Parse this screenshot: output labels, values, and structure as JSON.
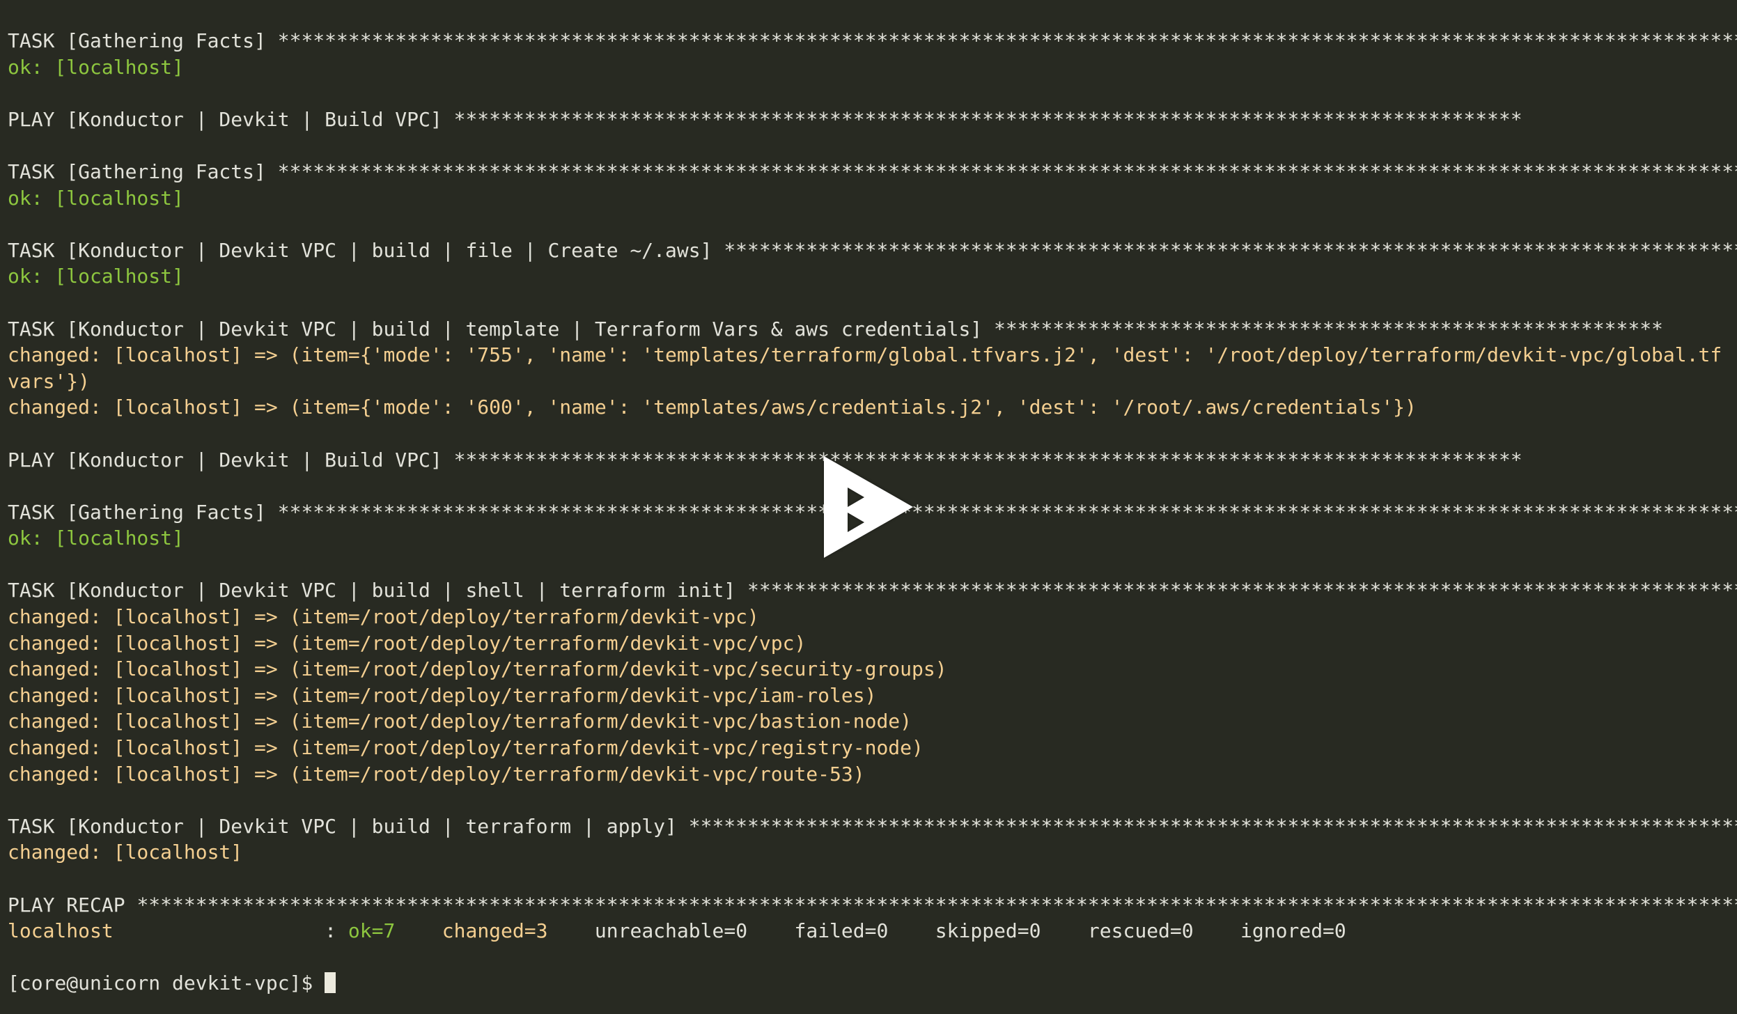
{
  "terminal": {
    "background_color": "#282a22",
    "foreground_color": "#e2e2da",
    "ok_color": "#8dc63f",
    "changed_color": "#f4cf91",
    "cursor_color": "#eceade",
    "columns": 146,
    "lines": [
      {
        "id": "l01",
        "segments": [
          {
            "cls": "c-default",
            "text": "TASK [Gathering Facts] "
          },
          {
            "cls": "c-stars",
            "text": "*****************************************************************************************************************************"
          }
        ]
      },
      {
        "id": "l02",
        "segments": [
          {
            "cls": "c-ok",
            "text": "ok: [localhost]"
          }
        ]
      },
      {
        "id": "l03",
        "segments": [
          {
            "cls": "c-default",
            "text": ""
          }
        ]
      },
      {
        "id": "l04",
        "segments": [
          {
            "cls": "c-default",
            "text": "PLAY [Konductor | Devkit | Build VPC] "
          },
          {
            "cls": "c-stars",
            "text": "*******************************************************************************************"
          }
        ]
      },
      {
        "id": "l05",
        "segments": [
          {
            "cls": "c-default",
            "text": ""
          }
        ]
      },
      {
        "id": "l06",
        "segments": [
          {
            "cls": "c-default",
            "text": "TASK [Gathering Facts] "
          },
          {
            "cls": "c-stars",
            "text": "*****************************************************************************************************************************"
          }
        ]
      },
      {
        "id": "l07",
        "segments": [
          {
            "cls": "c-ok",
            "text": "ok: [localhost]"
          }
        ]
      },
      {
        "id": "l08",
        "segments": [
          {
            "cls": "c-default",
            "text": ""
          }
        ]
      },
      {
        "id": "l09",
        "segments": [
          {
            "cls": "c-default",
            "text": "TASK [Konductor | Devkit VPC | build | file | Create ~/.aws] "
          },
          {
            "cls": "c-stars",
            "text": "********************************************************************************************"
          }
        ]
      },
      {
        "id": "l10",
        "segments": [
          {
            "cls": "c-ok",
            "text": "ok: [localhost]"
          }
        ]
      },
      {
        "id": "l11",
        "segments": [
          {
            "cls": "c-default",
            "text": ""
          }
        ]
      },
      {
        "id": "l12",
        "segments": [
          {
            "cls": "c-default",
            "text": "TASK [Konductor | Devkit VPC | build | template | Terraform Vars & aws credentials] "
          },
          {
            "cls": "c-stars",
            "text": "*********************************************************"
          }
        ]
      },
      {
        "id": "l13",
        "segments": [
          {
            "cls": "c-changed",
            "text": "changed: [localhost] => (item={'mode': '755', 'name': 'templates/terraform/global.tfvars.j2', 'dest': '/root/deploy/terraform/devkit-vpc/global.tf"
          }
        ]
      },
      {
        "id": "l14",
        "segments": [
          {
            "cls": "c-changed",
            "text": "vars'})"
          }
        ]
      },
      {
        "id": "l15",
        "segments": [
          {
            "cls": "c-changed",
            "text": "changed: [localhost] => (item={'mode': '600', 'name': 'templates/aws/credentials.j2', 'dest': '/root/.aws/credentials'})"
          }
        ]
      },
      {
        "id": "l16",
        "segments": [
          {
            "cls": "c-default",
            "text": ""
          }
        ]
      },
      {
        "id": "l17",
        "segments": [
          {
            "cls": "c-default",
            "text": "PLAY [Konductor | Devkit | Build VPC] "
          },
          {
            "cls": "c-stars",
            "text": "*******************************************************************************************"
          }
        ]
      },
      {
        "id": "l18",
        "segments": [
          {
            "cls": "c-default",
            "text": ""
          }
        ]
      },
      {
        "id": "l19",
        "segments": [
          {
            "cls": "c-default",
            "text": "TASK [Gathering Facts] "
          },
          {
            "cls": "c-stars",
            "text": "*****************************************************************************************************************************"
          }
        ]
      },
      {
        "id": "l20",
        "segments": [
          {
            "cls": "c-ok",
            "text": "ok: [localhost]"
          }
        ]
      },
      {
        "id": "l21",
        "segments": [
          {
            "cls": "c-default",
            "text": ""
          }
        ]
      },
      {
        "id": "l22",
        "segments": [
          {
            "cls": "c-default",
            "text": "TASK [Konductor | Devkit VPC | build | shell | terraform init] "
          },
          {
            "cls": "c-stars",
            "text": "******************************************************************************************"
          }
        ]
      },
      {
        "id": "l23",
        "segments": [
          {
            "cls": "c-changed",
            "text": "changed: [localhost] => (item=/root/deploy/terraform/devkit-vpc)"
          }
        ]
      },
      {
        "id": "l24",
        "segments": [
          {
            "cls": "c-changed",
            "text": "changed: [localhost] => (item=/root/deploy/terraform/devkit-vpc/vpc)"
          }
        ]
      },
      {
        "id": "l25",
        "segments": [
          {
            "cls": "c-changed",
            "text": "changed: [localhost] => (item=/root/deploy/terraform/devkit-vpc/security-groups)"
          }
        ]
      },
      {
        "id": "l26",
        "segments": [
          {
            "cls": "c-changed",
            "text": "changed: [localhost] => (item=/root/deploy/terraform/devkit-vpc/iam-roles)"
          }
        ]
      },
      {
        "id": "l27",
        "segments": [
          {
            "cls": "c-changed",
            "text": "changed: [localhost] => (item=/root/deploy/terraform/devkit-vpc/bastion-node)"
          }
        ]
      },
      {
        "id": "l28",
        "segments": [
          {
            "cls": "c-changed",
            "text": "changed: [localhost] => (item=/root/deploy/terraform/devkit-vpc/registry-node)"
          }
        ]
      },
      {
        "id": "l29",
        "segments": [
          {
            "cls": "c-changed",
            "text": "changed: [localhost] => (item=/root/deploy/terraform/devkit-vpc/route-53)"
          }
        ]
      },
      {
        "id": "l30",
        "segments": [
          {
            "cls": "c-default",
            "text": ""
          }
        ]
      },
      {
        "id": "l31",
        "segments": [
          {
            "cls": "c-default",
            "text": "TASK [Konductor | Devkit VPC | build | terraform | apply] "
          },
          {
            "cls": "c-stars",
            "text": "***********************************************************************************************"
          }
        ]
      },
      {
        "id": "l32",
        "segments": [
          {
            "cls": "c-changed",
            "text": "changed: [localhost]"
          }
        ]
      },
      {
        "id": "l33",
        "segments": [
          {
            "cls": "c-default",
            "text": ""
          }
        ]
      },
      {
        "id": "l34",
        "segments": [
          {
            "cls": "c-default",
            "text": "PLAY RECAP "
          },
          {
            "cls": "c-stars",
            "text": "*****************************************************************************************************************************************"
          }
        ]
      },
      {
        "id": "l35",
        "segments": [
          {
            "cls": "c-changed",
            "text": "localhost"
          },
          {
            "cls": "c-default",
            "text": "                  : "
          },
          {
            "cls": "c-ok",
            "text": "ok=7"
          },
          {
            "cls": "c-default",
            "text": "    "
          },
          {
            "cls": "c-changed",
            "text": "changed=3"
          },
          {
            "cls": "c-default",
            "text": "    unreachable=0    failed=0    skipped=0    rescued=0    ignored=0"
          }
        ]
      },
      {
        "id": "l36",
        "segments": [
          {
            "cls": "c-default",
            "text": ""
          }
        ]
      },
      {
        "id": "l37",
        "segments": [
          {
            "cls": "c-prompt",
            "text": "[core@unicorn devkit-vpc]$ "
          },
          {
            "cls": "cursor-slot",
            "text": ""
          }
        ]
      }
    ]
  },
  "player": {
    "play_button_label": "Play",
    "play_button_color": "#ffffff"
  }
}
